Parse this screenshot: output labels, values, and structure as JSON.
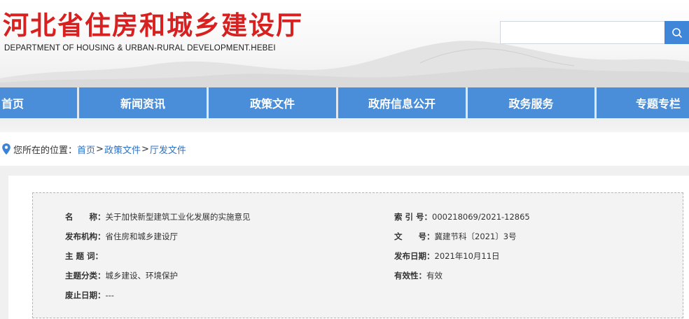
{
  "header": {
    "title": "河北省住房和城乡建设厅",
    "subtitle": "DEPARTMENT OF HOUSING & URBAN-RURAL DEVELOPMENT.HEBEI",
    "search": {
      "value": "",
      "placeholder": ""
    },
    "search_icon": "search-icon"
  },
  "nav": {
    "items": [
      {
        "label": "首页"
      },
      {
        "label": "新闻资讯"
      },
      {
        "label": "政策文件"
      },
      {
        "label": "政府信息公开"
      },
      {
        "label": "政务服务"
      },
      {
        "label": "专题专栏"
      }
    ]
  },
  "breadcrumb": {
    "prefix": "您所在的位置：",
    "items": [
      "首页",
      "政策文件",
      "厅发文件"
    ],
    "separator": ">"
  },
  "document_info": {
    "name": {
      "label": "名　　称：",
      "value": "关于加快新型建筑工业化发展的实施意见"
    },
    "index_no": {
      "label": "索 引 号：",
      "value": "000218069/2021-12865"
    },
    "publisher": {
      "label": "发布机构：",
      "value": "省住房和城乡建设厅"
    },
    "doc_no": {
      "label": "文　　号：",
      "value": "冀建节科〔2021〕3号"
    },
    "keywords": {
      "label": "主 题 词：",
      "value": ""
    },
    "publish_date": {
      "label": "发布日期：",
      "value": "2021年10月11日"
    },
    "category": {
      "label": "主题分类：",
      "value": "城乡建设、环境保护"
    },
    "validity": {
      "label": "有效性：",
      "value": "有效"
    },
    "expiry_date": {
      "label": "废止日期：",
      "value": "---"
    }
  },
  "colors": {
    "title_red": "#d7201f",
    "nav_blue": "#4a8ed9",
    "link_blue": "#2c72c7"
  }
}
